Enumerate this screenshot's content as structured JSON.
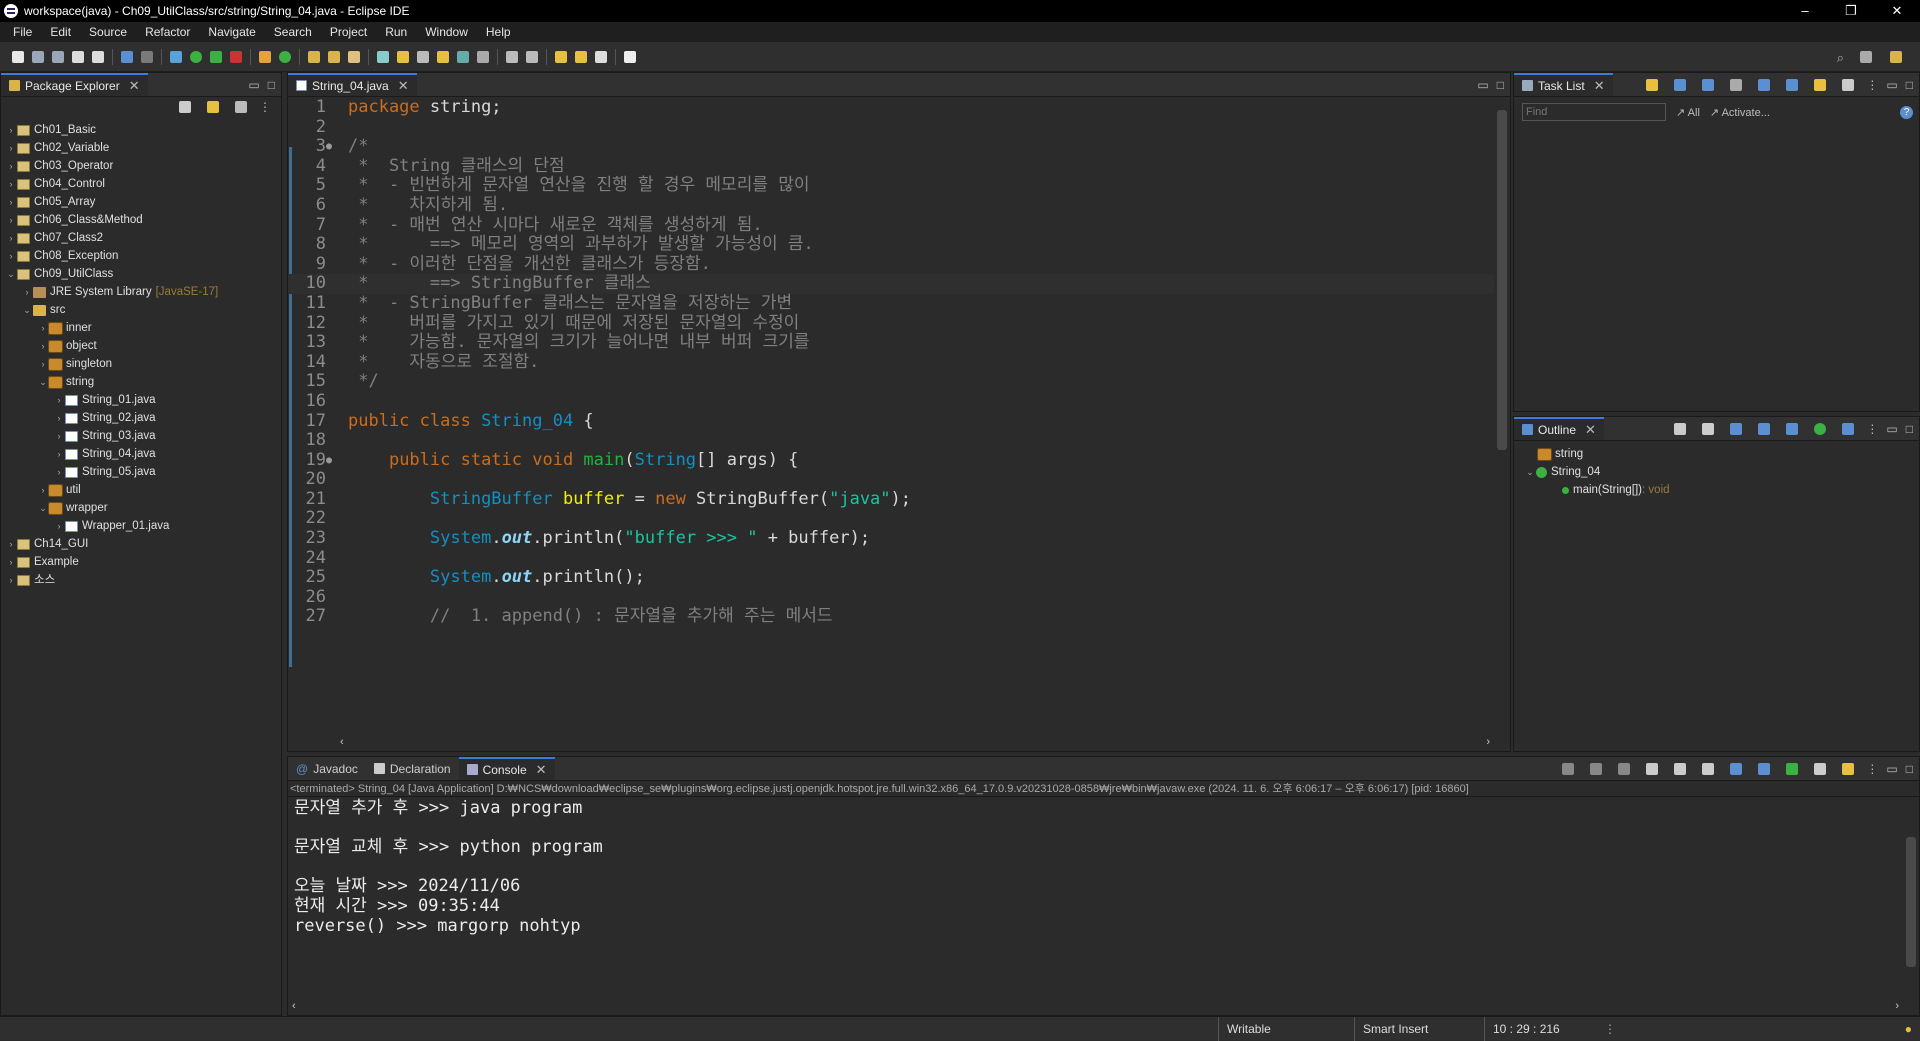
{
  "window": {
    "title": "workspace(java) - Ch09_UtilClass/src/string/String_04.java - Eclipse IDE",
    "minimize": "–",
    "restore": "❐",
    "close": "✕"
  },
  "menu": [
    "File",
    "Edit",
    "Source",
    "Refactor",
    "Navigate",
    "Search",
    "Project",
    "Run",
    "Window",
    "Help"
  ],
  "package_explorer": {
    "tab": "Package Explorer",
    "items": [
      {
        "label": "Ch01_Basic",
        "level": 0,
        "arrow": "›",
        "icon": "project"
      },
      {
        "label": "Ch02_Variable",
        "level": 0,
        "arrow": "›",
        "icon": "project"
      },
      {
        "label": "Ch03_Operator",
        "level": 0,
        "arrow": "›",
        "icon": "project"
      },
      {
        "label": "Ch04_Control",
        "level": 0,
        "arrow": "›",
        "icon": "project"
      },
      {
        "label": "Ch05_Array",
        "level": 0,
        "arrow": "›",
        "icon": "project"
      },
      {
        "label": "Ch06_Class&Method",
        "level": 0,
        "arrow": "›",
        "icon": "project"
      },
      {
        "label": "Ch07_Class2",
        "level": 0,
        "arrow": "›",
        "icon": "project"
      },
      {
        "label": "Ch08_Exception",
        "level": 0,
        "arrow": "›",
        "icon": "project"
      },
      {
        "label": "Ch09_UtilClass",
        "level": 0,
        "arrow": "⌄",
        "icon": "project"
      },
      {
        "label": "JRE System Library",
        "extra": "[JavaSE-17]",
        "level": 1,
        "arrow": "›",
        "icon": "library"
      },
      {
        "label": "src",
        "level": 1,
        "arrow": "⌄",
        "icon": "srcfolder"
      },
      {
        "label": "inner",
        "level": 2,
        "arrow": "›",
        "icon": "package"
      },
      {
        "label": "object",
        "level": 2,
        "arrow": "›",
        "icon": "package"
      },
      {
        "label": "singleton",
        "level": 2,
        "arrow": "›",
        "icon": "package"
      },
      {
        "label": "string",
        "level": 2,
        "arrow": "⌄",
        "icon": "package"
      },
      {
        "label": "String_01.java",
        "level": 3,
        "arrow": "›",
        "icon": "java"
      },
      {
        "label": "String_02.java",
        "level": 3,
        "arrow": "›",
        "icon": "java"
      },
      {
        "label": "String_03.java",
        "level": 3,
        "arrow": "›",
        "icon": "java"
      },
      {
        "label": "String_04.java",
        "level": 3,
        "arrow": "›",
        "icon": "java"
      },
      {
        "label": "String_05.java",
        "level": 3,
        "arrow": "›",
        "icon": "java"
      },
      {
        "label": "util",
        "level": 2,
        "arrow": "›",
        "icon": "package"
      },
      {
        "label": "wrapper",
        "level": 2,
        "arrow": "⌄",
        "icon": "package"
      },
      {
        "label": "Wrapper_01.java",
        "level": 3,
        "arrow": "›",
        "icon": "java"
      },
      {
        "label": "Ch14_GUI",
        "level": 0,
        "arrow": "›",
        "icon": "project"
      },
      {
        "label": "Example",
        "level": 0,
        "arrow": "›",
        "icon": "project"
      },
      {
        "label": "소스",
        "level": 0,
        "arrow": "›",
        "icon": "project"
      }
    ]
  },
  "editor": {
    "tab": "String_04.java",
    "lines": [
      {
        "n": "1",
        "t": [
          [
            "kw",
            "package"
          ],
          [
            "txt",
            " string;"
          ]
        ]
      },
      {
        "n": "2",
        "t": []
      },
      {
        "n": "3",
        "m": "●",
        "t": [
          [
            "cm",
            "/*"
          ]
        ]
      },
      {
        "n": "4",
        "t": [
          [
            "cm",
            " *  String 클래스의 단점"
          ]
        ]
      },
      {
        "n": "5",
        "t": [
          [
            "cm",
            " *  - 빈번하게 문자열 연산을 진행 할 경우 메모리를 많이"
          ]
        ]
      },
      {
        "n": "6",
        "t": [
          [
            "cm",
            " *    차지하게 됨."
          ]
        ]
      },
      {
        "n": "7",
        "t": [
          [
            "cm",
            " *  - 매번 연산 시마다 새로운 객체를 생성하게 됨."
          ]
        ]
      },
      {
        "n": "8",
        "t": [
          [
            "cm",
            " *      ==> 메모리 영역의 과부하가 발생할 가능성이 큼."
          ]
        ]
      },
      {
        "n": "9",
        "t": [
          [
            "cm",
            " *  - 이러한 단점을 개선한 클래스가 등장함."
          ]
        ]
      },
      {
        "n": "10",
        "cur": true,
        "t": [
          [
            "cm",
            " *      ==> StringBuffer 클래스"
          ]
        ]
      },
      {
        "n": "11",
        "t": [
          [
            "cm",
            " *  - StringBuffer 클래스는 문자열을 저장하는 가변"
          ]
        ]
      },
      {
        "n": "12",
        "t": [
          [
            "cm",
            " *    버퍼를 가지고 있기 때문에 저장된 문자열의 수정이"
          ]
        ]
      },
      {
        "n": "13",
        "t": [
          [
            "cm",
            " *    가능함. 문자열의 크기가 늘어나면 내부 버퍼 크기를"
          ]
        ]
      },
      {
        "n": "14",
        "t": [
          [
            "cm",
            " *    자동으로 조절함."
          ]
        ]
      },
      {
        "n": "15",
        "t": [
          [
            "cm",
            " */"
          ]
        ]
      },
      {
        "n": "16",
        "t": []
      },
      {
        "n": "17",
        "t": [
          [
            "kw",
            "public class "
          ],
          [
            "cls",
            "String_04"
          ],
          [
            "txt",
            " {"
          ]
        ]
      },
      {
        "n": "18",
        "t": []
      },
      {
        "n": "19",
        "m": "●",
        "t": [
          [
            "txt",
            "    "
          ],
          [
            "kw",
            "public static void "
          ],
          [
            "fn",
            "main"
          ],
          [
            "txt",
            "("
          ],
          [
            "ty",
            "String"
          ],
          [
            "txt",
            "[] "
          ],
          [
            "txt",
            "args) {"
          ]
        ]
      },
      {
        "n": "20",
        "t": []
      },
      {
        "n": "21",
        "t": [
          [
            "txt",
            "        "
          ],
          [
            "ty",
            "StringBuffer"
          ],
          [
            "var",
            " buffer"
          ],
          [
            "txt",
            " = "
          ],
          [
            "kw",
            "new "
          ],
          [
            "txt",
            "StringBuffer("
          ],
          [
            "st",
            "\"java\""
          ],
          [
            "txt",
            ");"
          ]
        ]
      },
      {
        "n": "22",
        "t": []
      },
      {
        "n": "23",
        "t": [
          [
            "txt",
            "        "
          ],
          [
            "ty",
            "System"
          ],
          [
            "txt",
            "."
          ],
          [
            "it",
            "out"
          ],
          [
            "txt",
            ".println("
          ],
          [
            "st",
            "\"buffer >>> \""
          ],
          [
            "txt",
            " + buffer);"
          ]
        ]
      },
      {
        "n": "24",
        "t": []
      },
      {
        "n": "25",
        "t": [
          [
            "txt",
            "        "
          ],
          [
            "ty",
            "System"
          ],
          [
            "txt",
            "."
          ],
          [
            "it",
            "out"
          ],
          [
            "txt",
            ".println();"
          ]
        ]
      },
      {
        "n": "26",
        "t": []
      },
      {
        "n": "27",
        "t": [
          [
            "cm",
            "        //  1. append() : 문자열을 추가해 주는 메서드"
          ]
        ]
      }
    ]
  },
  "tasklist": {
    "tab": "Task List",
    "find_placeholder": "Find",
    "all": "All",
    "activate": "Activate..."
  },
  "outline": {
    "tab": "Outline",
    "items": [
      {
        "label": "string",
        "level": 0
      },
      {
        "label": "String_04",
        "level": 0,
        "arrow": "⌄"
      },
      {
        "label": "main(String[])",
        "type": " : void",
        "level": 1
      }
    ]
  },
  "bottom": {
    "tabs": [
      "Javadoc",
      "Declaration",
      "Console"
    ],
    "status": "<terminated> String_04 [Java Application] D:₩NCS₩download₩eclipse_se₩plugins₩org.eclipse.justj.openjdk.hotspot.jre.full.win32.x86_64_17.0.9.v20231028-0858₩jre₩bin₩javaw.exe  (2024. 11. 6. 오후 6:06:17 – 오후 6:06:17) [pid: 16860]",
    "output": [
      "문자열 추가 후 >>> java program",
      "",
      "문자열 교체 후 >>> python program",
      "",
      "오늘 날짜 >>> 2024/11/06",
      "현재 시간 >>> 09:35:44",
      "reverse() >>> margorp nohtyp"
    ]
  },
  "statusbar": {
    "writable": "Writable",
    "insert": "Smart Insert",
    "position": "10 : 29 : 216"
  }
}
